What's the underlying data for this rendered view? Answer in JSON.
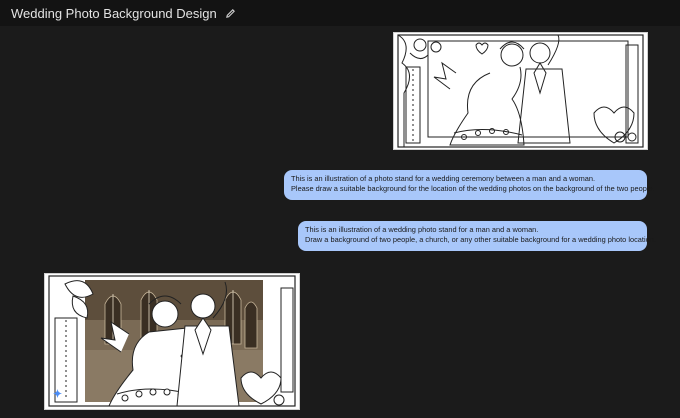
{
  "header": {
    "title": "Wedding Photo Background Design"
  },
  "messages": [
    {
      "role": "user",
      "lines": [
        "This is an illustration of a photo stand for a wedding ceremony between a man and a woman.",
        "Please draw a suitable background for the location of the wedding photos on the background of the two people."
      ]
    },
    {
      "role": "user",
      "lines": [
        "This is an illustration of a wedding photo stand for a man and a woman.",
        "Draw a background of two people, a church, or any other suitable background for a wedding photo location."
      ]
    }
  ],
  "images": {
    "uploaded": "wedding-photo-stand-lineart",
    "generated": "wedding-photo-stand-church-background"
  },
  "colors": {
    "bubble": "#a8c7fa",
    "background": "#1b1b1b",
    "header_bg": "#131313"
  },
  "icons": {
    "edit": "pencil-icon",
    "assistant": "sparkle-icon"
  }
}
